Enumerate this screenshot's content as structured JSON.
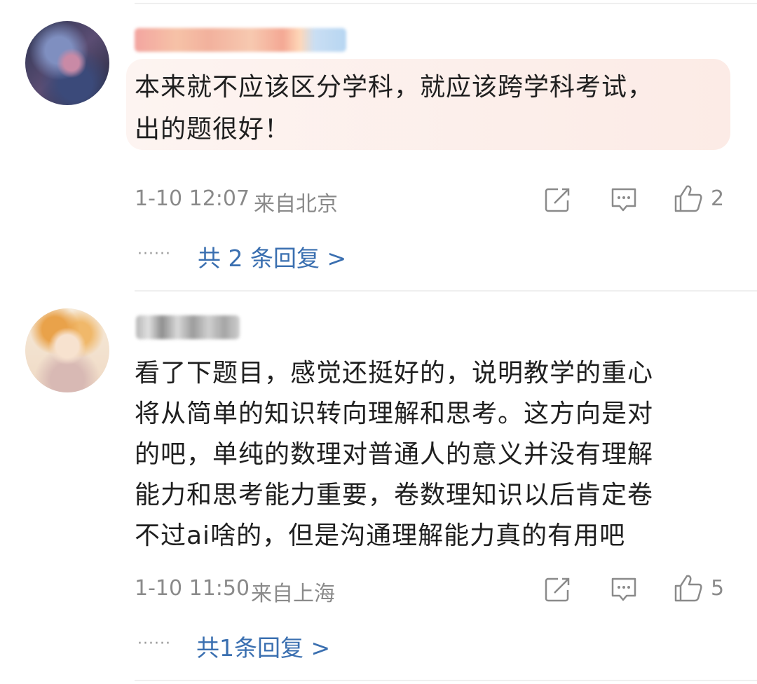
{
  "comments": [
    {
      "text_lines": [
        "本来就不应该区分学科，就应该跨学科考试，",
        "出的题很好！"
      ],
      "timestamp": "1-10 12:07",
      "location": "来自北京",
      "likes": "2",
      "reply_dots": "······",
      "replies_link": "共 2 条回复 >",
      "icons": [
        "share-icon",
        "comment-icon",
        "like-icon"
      ]
    },
    {
      "text_lines": [
        "看了下题目，感觉还挺好的，说明教学的重心",
        "将从简单的知识转向理解和思考。这方向是对",
        "的吧，单纯的数理对普通人的意义并没有理解",
        "能力和思考能力重要，卷数理知识以后肯定卷",
        "不过ai啥的，但是沟通理解能力真的有用吧"
      ],
      "timestamp": "1-10 11:50",
      "location": "来自上海",
      "likes": "5",
      "reply_dots": "······",
      "replies_link": "共1条回复 >",
      "icons": [
        "share-icon",
        "comment-icon",
        "like-icon"
      ]
    }
  ]
}
